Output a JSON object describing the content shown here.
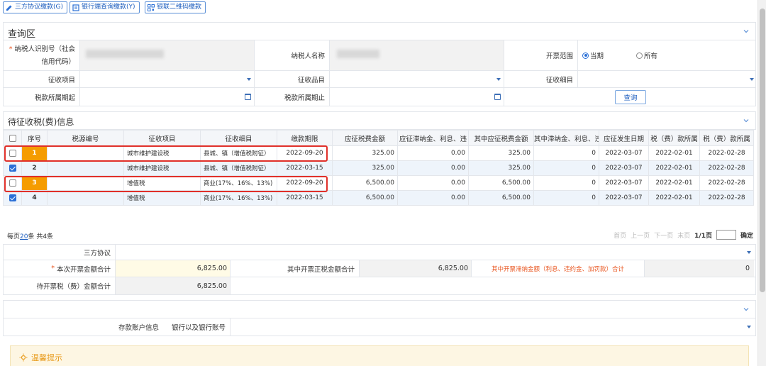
{
  "toolbar": {
    "btn1": "三方协议缴款(G)",
    "btn2": "银行端查询缴款(Y)",
    "btn3": "银联二维码缴款"
  },
  "query": {
    "title": "查询区",
    "taxpayer_id_label": "纳税人识别号（社会信用代码）",
    "taxpayer_name_label": "纳税人名称",
    "invoice_range_label": "开票范围",
    "radio_current": "当期",
    "radio_all": "所有",
    "item_label": "征收项目",
    "category_label": "征收品目",
    "subitem_label": "征收细目",
    "period_start_label": "税款所属期起",
    "period_end_label": "税款所属期止",
    "query_button": "查询"
  },
  "pending": {
    "title": "待征收税(费)信息",
    "columns": [
      "序号",
      "税源编号",
      "征收项目",
      "征收细目",
      "缴款期限",
      "应征税费金额",
      "应征滞纳金、利息、违",
      "其中应征税费金额",
      "其中滞纳金、利息、违",
      "应征发生日期",
      "税（费）款所属",
      "税（费）款所属"
    ],
    "rows": [
      {
        "no": "1",
        "src": "",
        "item": "城市维护建设税",
        "sub": "县城、镇（增值税附征）",
        "deadline": "2022-09-20",
        "amount": "325.00",
        "late": "0.00",
        "tax_amt": "325.00",
        "late2": "0",
        "date": "2022-03-07",
        "from": "2022-02-01",
        "to": "2022-02-28",
        "checked": false,
        "highlight": true
      },
      {
        "no": "2",
        "src": "",
        "item": "城市维护建设税",
        "sub": "县城、镇（增值税附征）",
        "deadline": "2022-03-15",
        "amount": "325.00",
        "late": "0.00",
        "tax_amt": "325.00",
        "late2": "0",
        "date": "2022-03-07",
        "from": "2022-02-01",
        "to": "2022-02-28",
        "checked": true,
        "highlight": false
      },
      {
        "no": "3",
        "src": "",
        "item": "增值税",
        "sub": "商业(17%、16%、13%)",
        "deadline": "2022-09-20",
        "amount": "6,500.00",
        "late": "0.00",
        "tax_amt": "6,500.00",
        "late2": "0",
        "date": "2022-03-07",
        "from": "2022-02-01",
        "to": "2022-02-28",
        "checked": false,
        "highlight": true
      },
      {
        "no": "4",
        "src": "",
        "item": "增值税",
        "sub": "商业(17%、16%、13%)",
        "deadline": "2022-03-15",
        "amount": "6,500.00",
        "late": "0.00",
        "tax_amt": "6,500.00",
        "late2": "0",
        "date": "2022-03-07",
        "from": "2022-02-01",
        "to": "2022-02-28",
        "checked": true,
        "highlight": false
      }
    ],
    "pager_prefix": "每页",
    "page_size": "20",
    "pager_suffix": "条 共4条",
    "first": "首页",
    "prev": "上一页",
    "next": "下一页",
    "last": "末页",
    "page_info": "1/1页",
    "confirm": "确定"
  },
  "summary": {
    "agreement_label": "三方协议",
    "total_label": "本次开票金额合计",
    "total_value": "6,825.00",
    "tax_total_label": "其中开票正税金额合计",
    "tax_total_value": "6,825.00",
    "late_total_label": "其中开票滞纳金额（利息、违约金、加罚款）合计",
    "late_total_value": "0",
    "pending_label": "待开票税（费）金额合计",
    "pending_value": "6,825.00",
    "deposit_label": "存款账户信息",
    "bank_label": "银行以及银行账号"
  },
  "tips": {
    "title": "温馨提示"
  },
  "colors": {
    "accent": "#2a6fd6",
    "highlight_orange": "#f59c00",
    "red_box": "#e0302a",
    "late_label": "#e8541e"
  }
}
